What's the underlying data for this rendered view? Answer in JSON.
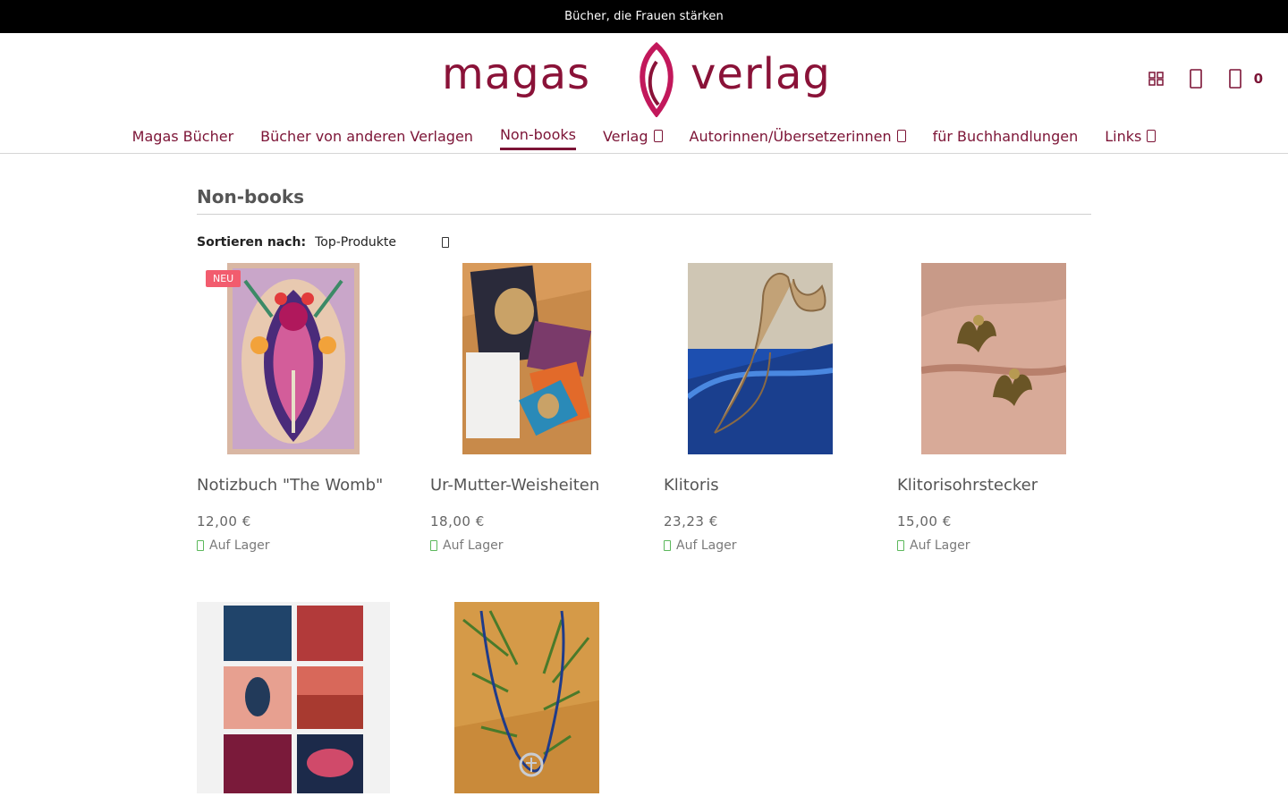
{
  "topbar": {
    "text": "Bücher, die Frauen stärken"
  },
  "logo": {
    "left": "magas",
    "right": "verlag"
  },
  "header": {
    "cart_count": "0"
  },
  "nav": {
    "items": [
      {
        "label": "Magas Bücher"
      },
      {
        "label": "Bücher von anderen Verlagen"
      },
      {
        "label": "Non-books"
      },
      {
        "label": "Verlag"
      },
      {
        "label": "Autorinnen/Übersetzerinnen"
      },
      {
        "label": "für Buchhandlungen"
      },
      {
        "label": "Links"
      }
    ]
  },
  "page": {
    "title": "Non-books",
    "sort_label": "Sortieren nach:",
    "sort_value": "Top-Produkte"
  },
  "products": [
    {
      "name": "Notizbuch \"The Womb\"",
      "price": "12,00 €",
      "stock": "Auf Lager",
      "badge": "NEU"
    },
    {
      "name": "Ur-Mutter-Weisheiten",
      "price": "18,00 €",
      "stock": "Auf Lager"
    },
    {
      "name": "Klitoris",
      "price": "23,23 €",
      "stock": "Auf Lager"
    },
    {
      "name": "Klitorisohrstecker",
      "price": "15,00 €",
      "stock": "Auf Lager"
    },
    {
      "name": "",
      "price": "",
      "stock": ""
    },
    {
      "name": "",
      "price": "",
      "stock": ""
    }
  ],
  "colors": {
    "brand": "#7c1436",
    "badge": "#f25c6e",
    "stock": "#5cb85c"
  }
}
